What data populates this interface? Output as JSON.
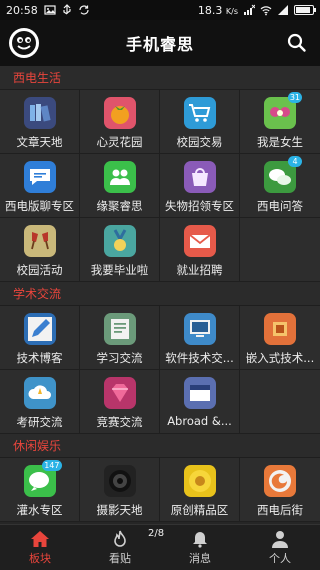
{
  "status": {
    "time": "20:58",
    "speed": "18.3",
    "speed_unit": "K/s",
    "battery_level": 0.85
  },
  "header": {
    "title": "手机睿思"
  },
  "sections": [
    {
      "title": "西电生活",
      "items": [
        {
          "label": "文章天地",
          "icon": "books-icon",
          "color": "#3b4a7e",
          "badge": ""
        },
        {
          "label": "心灵花园",
          "icon": "tomato-icon",
          "color": "#e0546b",
          "badge": ""
        },
        {
          "label": "校园交易",
          "icon": "cart-icon",
          "color": "#2e9bd7",
          "badge": ""
        },
        {
          "label": "我是女生",
          "icon": "bow-icon",
          "color": "#6ac14d",
          "badge": "31"
        },
        {
          "label": "西电版聊专区",
          "icon": "chat-bubble-icon",
          "color": "#2f7ed8",
          "badge": ""
        },
        {
          "label": "缘聚睿思",
          "icon": "couple-icon",
          "color": "#3bbf4a",
          "badge": ""
        },
        {
          "label": "失物招领专区",
          "icon": "bag-icon",
          "color": "#8a5bb8",
          "badge": ""
        },
        {
          "label": "西电问答",
          "icon": "wechat-icon",
          "color": "#3c9a3f",
          "badge": "4"
        },
        {
          "label": "校园活动",
          "icon": "cheers-icon",
          "color": "#c9b87a",
          "badge": ""
        },
        {
          "label": "我要毕业啦",
          "icon": "medal-icon",
          "color": "#4aa6a0",
          "badge": ""
        },
        {
          "label": "就业招聘",
          "icon": "envelope-icon",
          "color": "#e65a4a",
          "badge": ""
        }
      ]
    },
    {
      "title": "学术交流",
      "items": [
        {
          "label": "技术博客",
          "icon": "pencil-icon",
          "color": "#2c6db4",
          "badge": ""
        },
        {
          "label": "学习交流",
          "icon": "notes-icon",
          "color": "#6b9a7a",
          "badge": ""
        },
        {
          "label": "软件技术交...",
          "icon": "monitor-icon",
          "color": "#3e8ac9",
          "badge": ""
        },
        {
          "label": "嵌入式技术...",
          "icon": "chip-icon",
          "color": "#e2713a",
          "badge": ""
        },
        {
          "label": "考研交流",
          "icon": "cloud-icon",
          "color": "#3f93c9",
          "badge": ""
        },
        {
          "label": "竞赛交流",
          "icon": "diamond-icon",
          "color": "#b8356a",
          "badge": ""
        },
        {
          "label": "Abroad &...",
          "icon": "english-book-icon",
          "color": "#5b6fb1",
          "badge": ""
        }
      ]
    },
    {
      "title": "休闲娱乐",
      "items": [
        {
          "label": "灌水专区",
          "icon": "chat-bubbles-icon",
          "color": "#3bbf4a",
          "badge": "147"
        },
        {
          "label": "摄影天地",
          "icon": "camera-lens-icon",
          "color": "#222222",
          "badge": ""
        },
        {
          "label": "原创精品区",
          "icon": "sunflower-icon",
          "color": "#e8c21b",
          "badge": ""
        },
        {
          "label": "西电后街",
          "icon": "firefox-icon",
          "color": "#e8793a",
          "badge": ""
        }
      ]
    }
  ],
  "tabbar": {
    "pager": "2/8",
    "tabs": [
      {
        "label": "板块",
        "icon": "home-icon"
      },
      {
        "label": "看贴",
        "icon": "flame-icon"
      },
      {
        "label": "消息",
        "icon": "bell-icon"
      },
      {
        "label": "个人",
        "icon": "person-icon"
      }
    ]
  }
}
